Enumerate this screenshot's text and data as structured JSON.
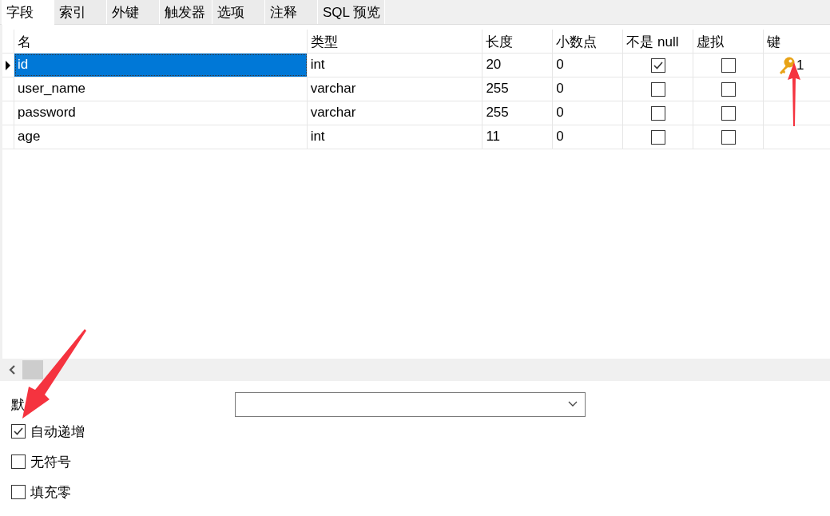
{
  "tabs": [
    {
      "label": "字段",
      "selected": true
    },
    {
      "label": "索引",
      "selected": false
    },
    {
      "label": "外键",
      "selected": false
    },
    {
      "label": "触发器",
      "selected": false
    },
    {
      "label": "选项",
      "selected": false
    },
    {
      "label": "注释",
      "selected": false
    },
    {
      "label": "SQL 预览",
      "selected": false
    }
  ],
  "table": {
    "columns": [
      "名",
      "类型",
      "长度",
      "小数点",
      "不是 null",
      "虚拟",
      "键"
    ],
    "rows": [
      {
        "name": "id",
        "type": "int",
        "length": "20",
        "decimals": "0",
        "not_null": true,
        "virtual": false,
        "key": "1",
        "selected": true
      },
      {
        "name": "user_name",
        "type": "varchar",
        "length": "255",
        "decimals": "0",
        "not_null": false,
        "virtual": false,
        "selected": false
      },
      {
        "name": "password",
        "type": "varchar",
        "length": "255",
        "decimals": "0",
        "not_null": false,
        "virtual": false,
        "selected": false
      },
      {
        "name": "age",
        "type": "int",
        "length": "11",
        "decimals": "0",
        "not_null": false,
        "virtual": false,
        "selected": false
      }
    ]
  },
  "default": {
    "label": "默"
  },
  "options": [
    {
      "label": "自动递增",
      "checked": true
    },
    {
      "label": "无符号",
      "checked": false
    },
    {
      "label": "填充零",
      "checked": false
    }
  ]
}
